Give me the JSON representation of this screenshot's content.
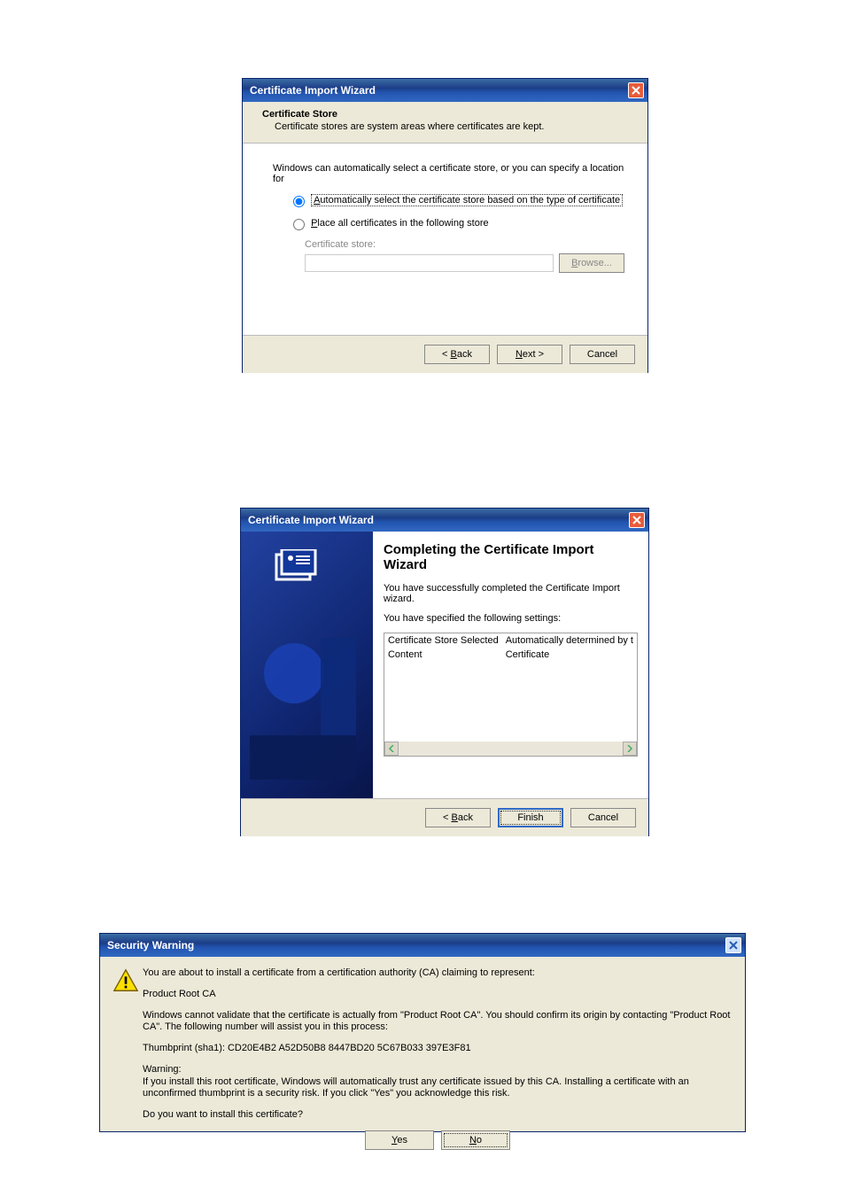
{
  "dlg1": {
    "title": "Certificate Import Wizard",
    "heading": "Certificate Store",
    "subheading": "Certificate stores are system areas where certificates are kept.",
    "intro": "Windows can automatically select a certificate store, or you can specify a location for",
    "radio_auto": "Automatically select the certificate store based on the type of certificate",
    "radio_place": "Place all certificates in the following store",
    "store_label": "Certificate store:",
    "browse": "Browse...",
    "back": "< Back",
    "next": "Next >",
    "cancel": "Cancel"
  },
  "dlg2": {
    "title": "Certificate Import Wizard",
    "heading": "Completing the Certificate Import Wizard",
    "line1": "You have successfully completed the Certificate Import wizard.",
    "line2": "You have specified the following settings:",
    "rows": [
      {
        "k": "Certificate Store Selected",
        "v": "Automatically determined by t"
      },
      {
        "k": "Content",
        "v": "Certificate"
      }
    ],
    "back": "< Back",
    "finish": "Finish",
    "cancel": "Cancel"
  },
  "dlg3": {
    "title": "Security Warning",
    "p1": "You are about to install a certificate from a certification authority (CA) claiming to represent:",
    "p2": "Product Root CA",
    "p3": "Windows cannot validate that the certificate is actually from \"Product Root CA\". You should confirm its origin by contacting \"Product Root CA\". The following number will assist you in this process:",
    "p4": "Thumbprint (sha1): CD20E4B2 A52D50B8 8447BD20 5C67B033 397E3F81",
    "p5a": "Warning:",
    "p5b": "If you install this root certificate, Windows will automatically trust any certificate issued by this CA. Installing a certificate with an unconfirmed thumbprint is a security risk. If you click \"Yes\" you acknowledge this risk.",
    "p6": "Do you want to install this certificate?",
    "yes": "Yes",
    "no": "No"
  }
}
